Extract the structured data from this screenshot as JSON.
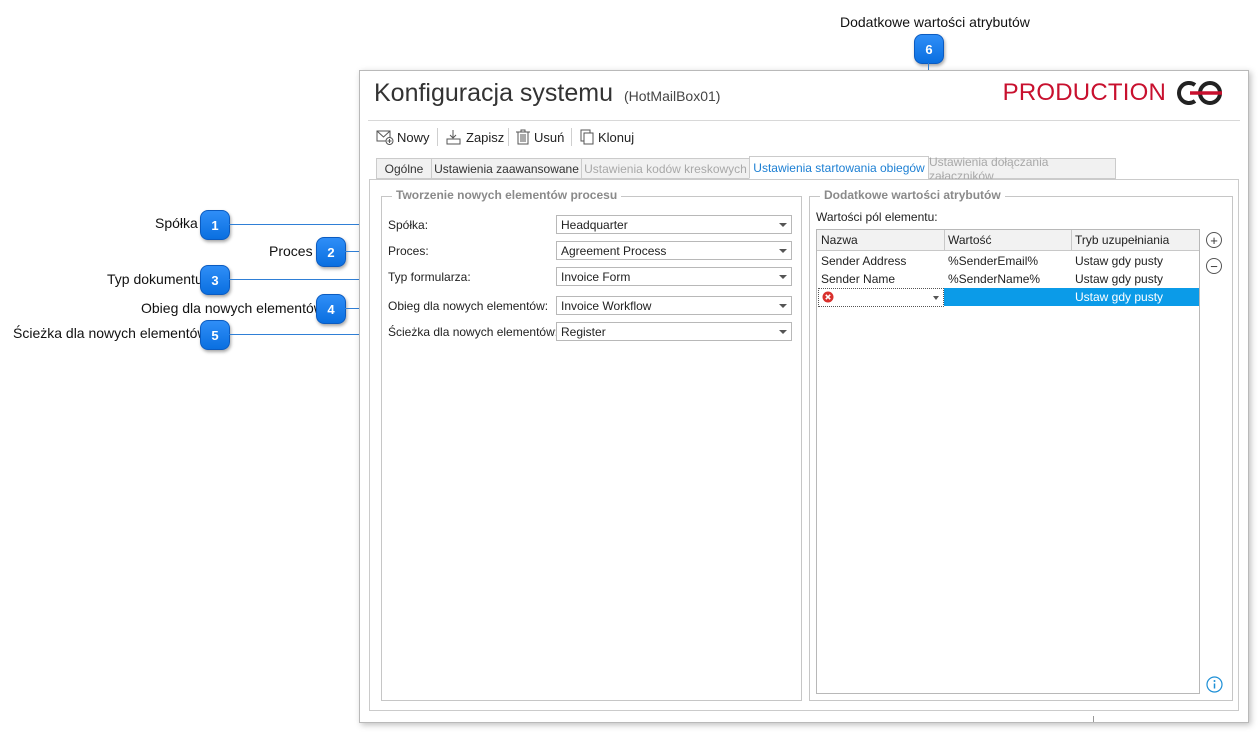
{
  "callouts": [
    {
      "n": "1",
      "label": "Spółka"
    },
    {
      "n": "2",
      "label": "Proces"
    },
    {
      "n": "3",
      "label": "Typ dokumentu"
    },
    {
      "n": "4",
      "label": "Obieg dla nowych elementów"
    },
    {
      "n": "5",
      "label": "Ścieżka dla nowych elementów"
    },
    {
      "n": "6",
      "label": "Dodatkowe wartości atrybutów"
    }
  ],
  "window": {
    "title": "Konfiguracja systemu",
    "subtitle": "(HotMailBox01)",
    "environment": "PRODUCTION",
    "brand_color": "#c8102e",
    "accent_color": "#1c7fd3"
  },
  "toolbar": {
    "new_label": "Nowy",
    "save_label": "Zapisz",
    "delete_label": "Usuń",
    "clone_label": "Klonuj"
  },
  "tabs": [
    {
      "label": "Ogólne",
      "state": "normal"
    },
    {
      "label": "Ustawienia zaawansowane",
      "state": "normal"
    },
    {
      "label": "Ustawienia kodów kreskowych",
      "state": "disabled"
    },
    {
      "label": "Ustawienia startowania obiegów",
      "state": "active"
    },
    {
      "label": "Ustawienia dołączania załączników",
      "state": "disabled"
    }
  ],
  "left_group": {
    "title": "Tworzenie nowych elementów procesu",
    "fields": [
      {
        "label": "Spółka:",
        "value": "Headquarter"
      },
      {
        "label": "Proces:",
        "value": "Agreement Process"
      },
      {
        "label": "Typ formularza:",
        "value": "Invoice Form"
      },
      {
        "label": "Obieg dla nowych elementów:",
        "value": "Invoice Workflow"
      },
      {
        "label": "Ścieżka dla nowych elementów:",
        "value": "Register"
      }
    ]
  },
  "right_group": {
    "title": "Dodatkowe wartości atrybutów",
    "grid_label": "Wartości pól elementu:",
    "columns": [
      "Nazwa",
      "Wartość",
      "Tryb uzupełniania"
    ],
    "rows": [
      [
        "Sender Address",
        "%SenderEmail%",
        "Ustaw gdy pusty"
      ],
      [
        "Sender Name",
        "%SenderName%",
        "Ustaw gdy pusty"
      ],
      [
        "",
        "",
        "Ustaw gdy pusty"
      ]
    ],
    "add_icon": "plus-circle-icon",
    "remove_icon": "minus-circle-icon",
    "info_icon": "info-icon"
  }
}
